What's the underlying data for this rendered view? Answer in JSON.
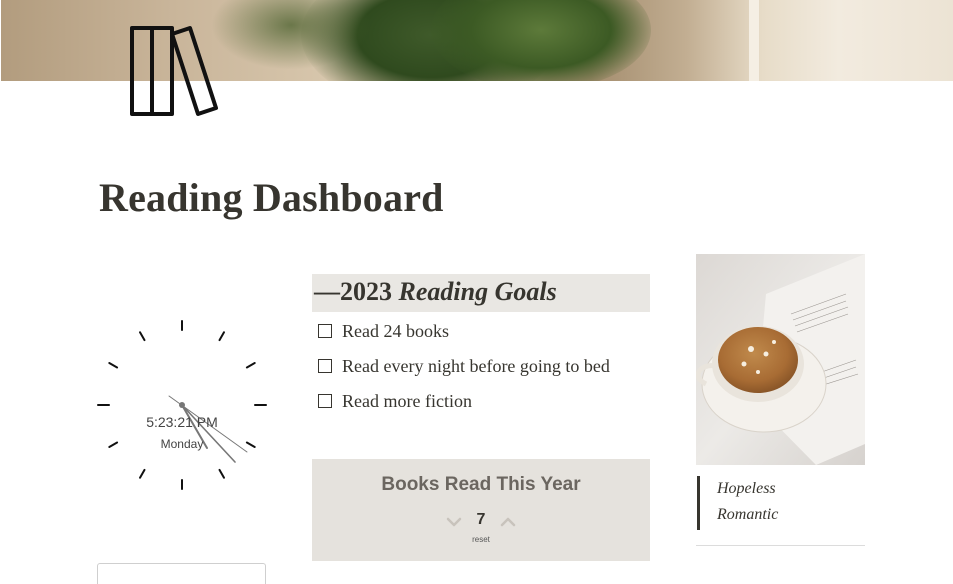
{
  "page": {
    "title": "Reading Dashboard",
    "icon": "books-icon"
  },
  "clock": {
    "time": "5:23:21 PM",
    "day": "Monday"
  },
  "goals": {
    "year_prefix": "—2023 ",
    "title": "Reading Goals",
    "items": [
      {
        "label": "Read 24 books",
        "checked": false
      },
      {
        "label": "Read every night before going to bed",
        "checked": false
      },
      {
        "label": "Read more fiction",
        "checked": false
      }
    ]
  },
  "counter": {
    "title": "Books Read This Year",
    "value": "7",
    "reset_label": "reset"
  },
  "quote": {
    "line1": "Hopeless",
    "line2": "Romantic"
  },
  "colors": {
    "text": "#37352f",
    "goals_header_bg": "#e9e7e3",
    "counter_bg": "#e5e2dd"
  }
}
